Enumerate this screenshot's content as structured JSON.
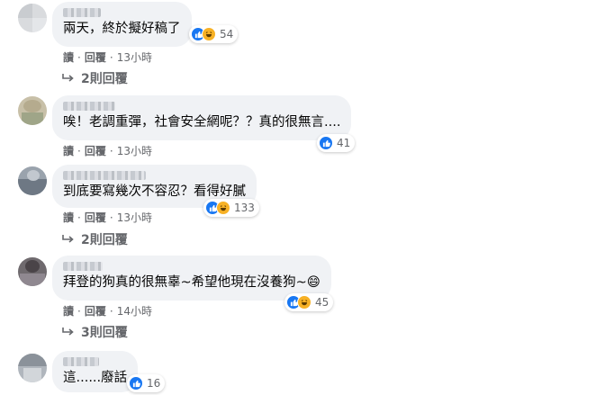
{
  "comments": [
    {
      "text": "兩天，終於擬好稿了",
      "reactions": {
        "types": [
          "like-icon",
          "haha-icon"
        ],
        "count": "54"
      },
      "meta": {
        "read": "讀",
        "reply": "回覆",
        "time": "13小時"
      },
      "replies": "2則回覆"
    },
    {
      "text": "唉！老調重彈，社會安全網呢？？真的很無言....",
      "reactions": {
        "types": [
          "like-icon"
        ],
        "count": "41"
      },
      "meta": {
        "read": "讀",
        "reply": "回覆",
        "time": "13小時"
      },
      "replies": ""
    },
    {
      "text": "到底要寫幾次不容忍？看得好膩",
      "reactions": {
        "types": [
          "like-icon",
          "haha-icon"
        ],
        "count": "133"
      },
      "meta": {
        "read": "讀",
        "reply": "回覆",
        "time": "13小時"
      },
      "replies": "2則回覆"
    },
    {
      "text": "拜登的狗真的很無辜~希望他現在沒養狗~😄",
      "reactions": {
        "types": [
          "like-icon",
          "haha-icon"
        ],
        "count": "45"
      },
      "meta": {
        "read": "讀",
        "reply": "回覆",
        "time": "14小時"
      },
      "replies": "3則回覆"
    },
    {
      "text": "這......廢話",
      "reactions": {
        "types": [
          "like-icon"
        ],
        "count": "16"
      },
      "meta": {
        "read": "",
        "reply": "",
        "time": ""
      },
      "replies": ""
    }
  ],
  "colors": {
    "bubble": "#f0f2f5",
    "like": "#1877f2",
    "haha": "#f7b125",
    "meta": "#65676b"
  }
}
